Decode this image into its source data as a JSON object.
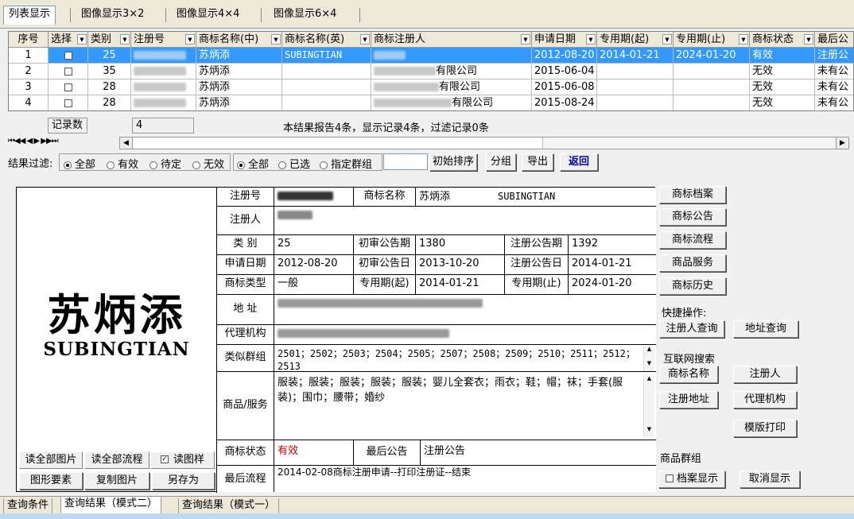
{
  "view_tabs": [
    "列表显示",
    "图像显示3×2",
    "图像显示4×4",
    "图像显示6×4"
  ],
  "grid": {
    "columns": [
      "序号",
      "选择",
      "类别",
      "注册号",
      "商标名称(中)",
      "商标名称(英)",
      "商标注册人",
      "申请日期",
      "专用期(起)",
      "专用期(止)",
      "商标状态",
      "最后公"
    ],
    "rows": [
      {
        "seq": "1",
        "cat": "25",
        "name_cn": "苏炳添",
        "name_en": "SUBINGTIAN",
        "owner": "",
        "apply": "2012-08-20",
        "start": "2014-01-21",
        "end": "2024-01-20",
        "status": "有效",
        "last": "注册公"
      },
      {
        "seq": "2",
        "cat": "35",
        "name_cn": "苏炳添",
        "name_en": "",
        "owner": "有限公司",
        "apply": "2015-06-04",
        "start": "",
        "end": "",
        "status": "无效",
        "last": "未有公"
      },
      {
        "seq": "3",
        "cat": "28",
        "name_cn": "苏炳添",
        "name_en": "",
        "owner": "有限公司",
        "apply": "2015-06-08",
        "start": "",
        "end": "",
        "status": "无效",
        "last": "未有公"
      },
      {
        "seq": "4",
        "cat": "28",
        "name_cn": "苏炳添",
        "name_en": "",
        "owner": "有限公司",
        "apply": "2015-08-24",
        "start": "",
        "end": "",
        "status": "无效",
        "last": "未有公"
      }
    ]
  },
  "record_count_label": "记录数",
  "record_count_value": "4",
  "summary": "本结果报告4条，显示记录4条，过滤记录0条",
  "nav_glyphs": "⏮◀◀ ◀ ▶ ▶▶⏭",
  "filter": {
    "label": "结果过滤:",
    "status_options": [
      "全部",
      "有效",
      "待定",
      "无效"
    ],
    "select_options": [
      "全部",
      "已选",
      "指定群组"
    ],
    "buttons": [
      "初始排序",
      "分组",
      "导出",
      "返回"
    ]
  },
  "detail": {
    "logo_cn": "苏炳添",
    "logo_en": "SUBINGTIAN",
    "labels": {
      "reg_no": "注册号",
      "tm_name": "商标名称",
      "owner": "注册人",
      "category": "类 别",
      "first_pub_no": "初审公告期",
      "reg_pub_no": "注册公告期",
      "apply_date": "申请日期",
      "first_pub_date": "初审公告日",
      "reg_pub_date": "注册公告日",
      "tm_type": "商标类型",
      "start": "专用期(起)",
      "end": "专用期(止)",
      "address": "地 址",
      "agent": "代理机构",
      "similar": "类似群组",
      "goods": "商品/服务",
      "status": "商标状态",
      "last_pub": "最后公告",
      "last_flow": "最后流程"
    },
    "values": {
      "tm_name_cn": "苏炳添",
      "tm_name_en": "SUBINGTIAN",
      "category": "25",
      "first_pub_no": "1380",
      "reg_pub_no": "1392",
      "apply_date": "2012-08-20",
      "first_pub_date": "2013-10-20",
      "reg_pub_date": "2014-01-21",
      "tm_type": "一般",
      "start": "2014-01-21",
      "end": "2024-01-20",
      "similar": "2501；2502；2503；2504；2505；2507；2508；2509；2510；2511；2512；2513",
      "goods": "服装；服装；服装；服装；服装；婴儿全套衣；雨衣；鞋；帽；袜；手套(服装)；围巾；腰带；婚纱",
      "status": "有效",
      "last_pub": "注册公告",
      "last_flow": "2014-02-08商标注册申请--打印注册证--结束"
    },
    "img_buttons": [
      "读全部图片",
      "读全部流程",
      "读图样",
      "图形要素",
      "复制图片",
      "另存为"
    ]
  },
  "side": {
    "buttons_top": [
      "商标档案",
      "商标公告",
      "商标流程",
      "商品服务",
      "商标历史"
    ],
    "quick_label": "快捷操作:",
    "quick_buttons": [
      "注册人查询",
      "地址查询"
    ],
    "web_label": "互联网搜索",
    "web_buttons": [
      "商标名称",
      "注册人",
      "注册地址",
      "代理机构"
    ],
    "print_button": "模版打印",
    "group_label": "商品群组",
    "archive_check": "档案显示",
    "cancel_button": "取消显示"
  },
  "bottom_tabs": [
    "查询条件",
    "查询结果（模式二）",
    "查询结果（模式一）"
  ],
  "colors": {
    "selected_row": "#3399ff",
    "status_valid": "#d00000"
  }
}
